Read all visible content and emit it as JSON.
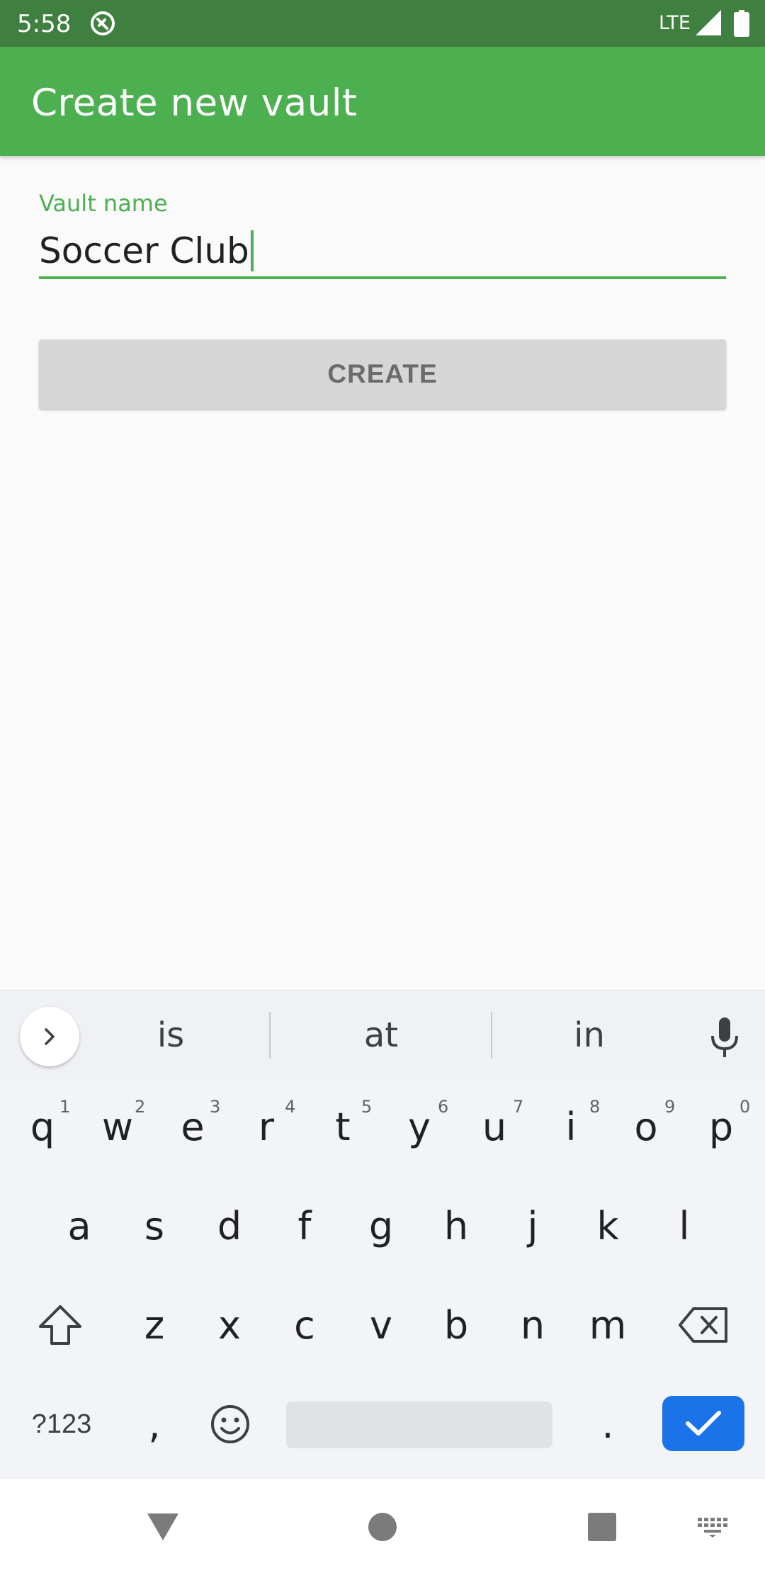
{
  "status_bar": {
    "time": "5:58",
    "network": "LTE",
    "icons": [
      "app-notification-icon",
      "signal-icon",
      "battery-icon"
    ]
  },
  "app_bar": {
    "title": "Create new vault",
    "color": "#4caf50"
  },
  "form": {
    "label": "Vault name",
    "value": "Soccer Club",
    "create_button": "CREATE"
  },
  "keyboard": {
    "suggestions": [
      "is",
      "at",
      "in"
    ],
    "row1": [
      {
        "key": "q",
        "hint": "1"
      },
      {
        "key": "w",
        "hint": "2"
      },
      {
        "key": "e",
        "hint": "3"
      },
      {
        "key": "r",
        "hint": "4"
      },
      {
        "key": "t",
        "hint": "5"
      },
      {
        "key": "y",
        "hint": "6"
      },
      {
        "key": "u",
        "hint": "7"
      },
      {
        "key": "i",
        "hint": "8"
      },
      {
        "key": "o",
        "hint": "9"
      },
      {
        "key": "p",
        "hint": "0"
      }
    ],
    "row2": [
      "a",
      "s",
      "d",
      "f",
      "g",
      "h",
      "j",
      "k",
      "l"
    ],
    "row3": [
      "z",
      "x",
      "c",
      "v",
      "b",
      "n",
      "m"
    ],
    "symbols_key": "?123",
    "comma_key": ",",
    "period_key": ".",
    "enter_color": "#1a73e8"
  },
  "nav_bar": {
    "icons": [
      "back-icon",
      "home-icon",
      "recents-icon",
      "keyboard-switch-icon"
    ]
  }
}
